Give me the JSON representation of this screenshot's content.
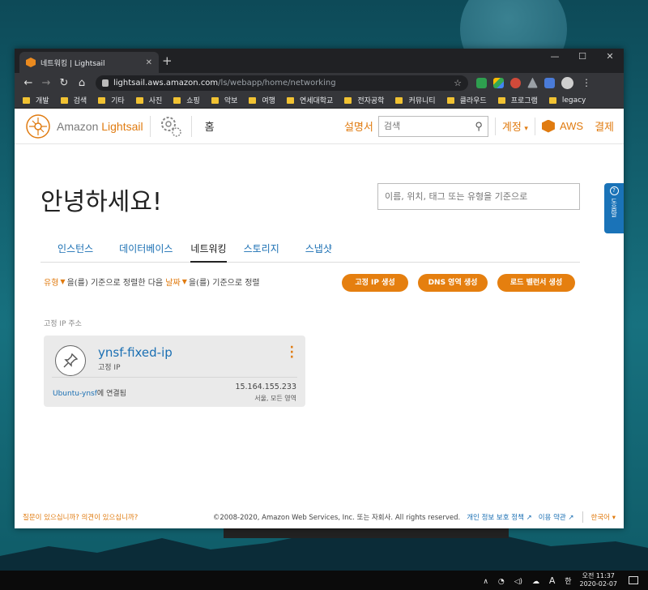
{
  "browser": {
    "tab_title": "네트워킹 | Lightsail",
    "url_host": "lightsail.aws.amazon.com",
    "url_path": "/ls/webapp/home/networking",
    "bookmarks": [
      "개발",
      "검색",
      "기타",
      "사진",
      "쇼핑",
      "악보",
      "여행",
      "연세대학교",
      "전자공학",
      "커뮤니티",
      "클라우드",
      "프로그램",
      "legacy"
    ]
  },
  "header": {
    "brand_prefix": "Amazon ",
    "brand_name": "Lightsail",
    "home": "홈",
    "docs": "설명서",
    "search_placeholder": "검색",
    "account": "계정",
    "aws": "AWS",
    "billing": "결제"
  },
  "help_tab": {
    "label": "도움말"
  },
  "main": {
    "greeting": "안녕하세요!",
    "search_placeholder": "이름, 위치, 태그 또는 유형을 기준으로",
    "tabs": [
      "인스턴스",
      "데이터베이스",
      "네트워킹",
      "스토리지",
      "스냅샷"
    ],
    "active_tab": "네트워킹",
    "sort": {
      "field1": "유형",
      "mid": "을(를) 기준으로 정렬한 다음",
      "field2": "날짜",
      "end": "을(를) 기준으로 정렬"
    },
    "buttons": {
      "static_ip": "고정 IP 생성",
      "dns": "DNS 영역 생성",
      "lb": "로드 밸런서 생성"
    },
    "section_label": "고정 IP 주소",
    "card": {
      "name": "ynsf-fixed-ip",
      "type": "고정 IP",
      "attached_link": "Ubuntu-ynsf",
      "attached_suffix": "에 연결됨",
      "ip": "15.164.155.233",
      "region": "서울, 모든 영역"
    }
  },
  "footer": {
    "question": "질문이 있으십니까? 의견이 있으십니까?",
    "copyright": "©2008-2020, Amazon Web Services, Inc. 또는 자회사. All rights reserved.",
    "privacy": "개인 정보 보호 정책",
    "terms": "이용 약관",
    "language": "한국어"
  },
  "taskbar": {
    "time": "오전 11:37",
    "date": "2020-02-07",
    "ime": "A",
    "hangul": "한"
  },
  "colors": {
    "accent_orange": "#e07b10",
    "link_blue": "#1a6fb3",
    "help_blue": "#1a73b8"
  }
}
